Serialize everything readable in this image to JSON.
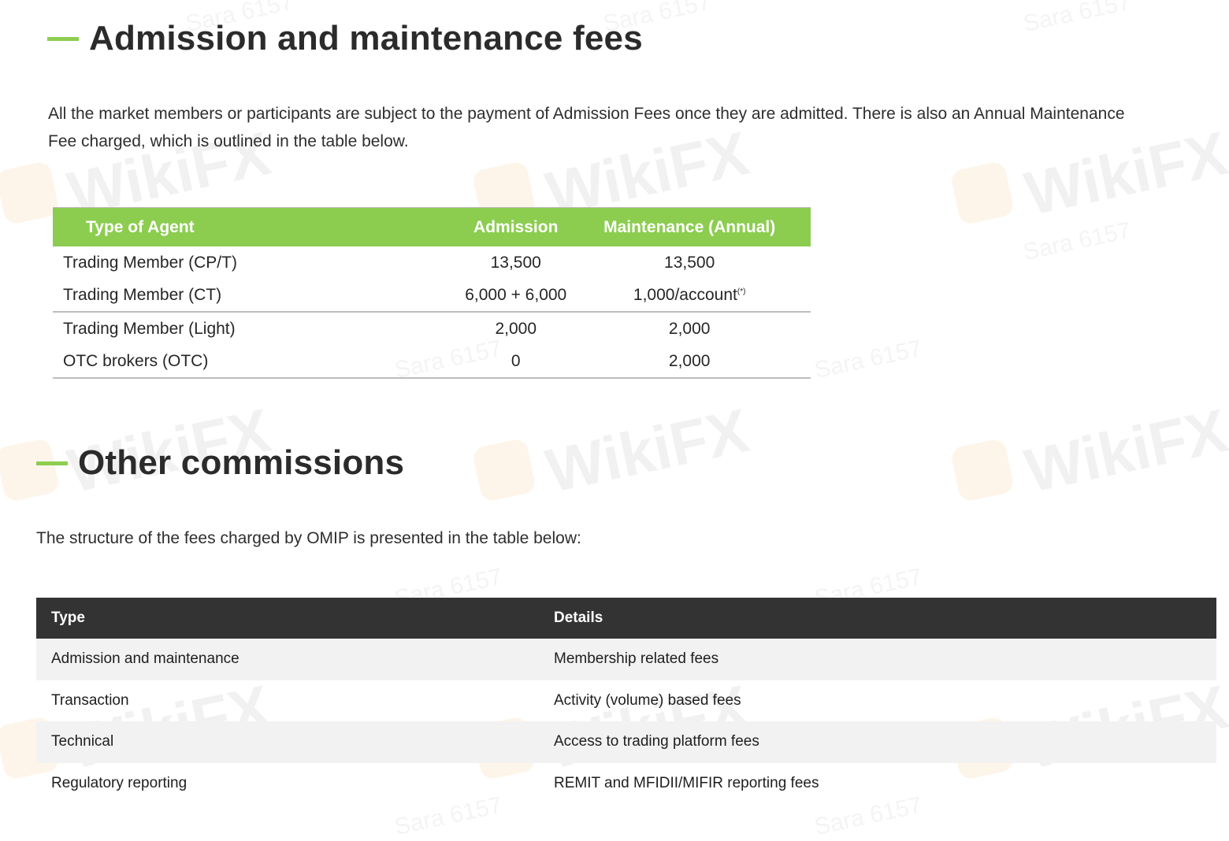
{
  "admission_section": {
    "title": "Admission and maintenance fees",
    "paragraph_line1": "All the market members or participants are subject to the payment of Admission Fees once they are admitted. There is also an Annual Maintenance",
    "paragraph_line2": "Fee charged, which is outlined in the table below.",
    "table": {
      "headers": [
        "Type of Agent",
        "Admission",
        "Maintenance (Annual)"
      ],
      "rows": [
        [
          "Trading Member (CP/T)",
          "13,500",
          "13,500"
        ],
        [
          "Trading Member (CT)",
          "6,000 + 6,000",
          "1,000/account"
        ],
        [
          "Trading Member (Light)",
          "2,000",
          "2,000"
        ],
        [
          "OTC brokers (OTC)",
          "0",
          "2,000"
        ]
      ],
      "footnote_mark": "(*)"
    }
  },
  "commissions_section": {
    "title": "Other commissions",
    "paragraph": "The structure of the fees charged by OMIP is presented in the table below:",
    "table": {
      "headers": [
        "Type",
        "Details"
      ],
      "rows": [
        [
          "Admission and maintenance",
          "Membership related fees"
        ],
        [
          "Transaction",
          "Activity (volume) based fees"
        ],
        [
          "Technical",
          "Access to trading platform fees"
        ],
        [
          "Regulatory reporting",
          "REMIT and MFIDII/MIFIR reporting fees"
        ]
      ]
    }
  },
  "watermark": {
    "brand": "WikiFX",
    "user": "Sara 6157"
  },
  "colors": {
    "accent_green": "#8dcd4f",
    "table_header_green": "#8ccd50",
    "table_header_dark": "#333333",
    "row_shade": "#f2f2f2"
  }
}
